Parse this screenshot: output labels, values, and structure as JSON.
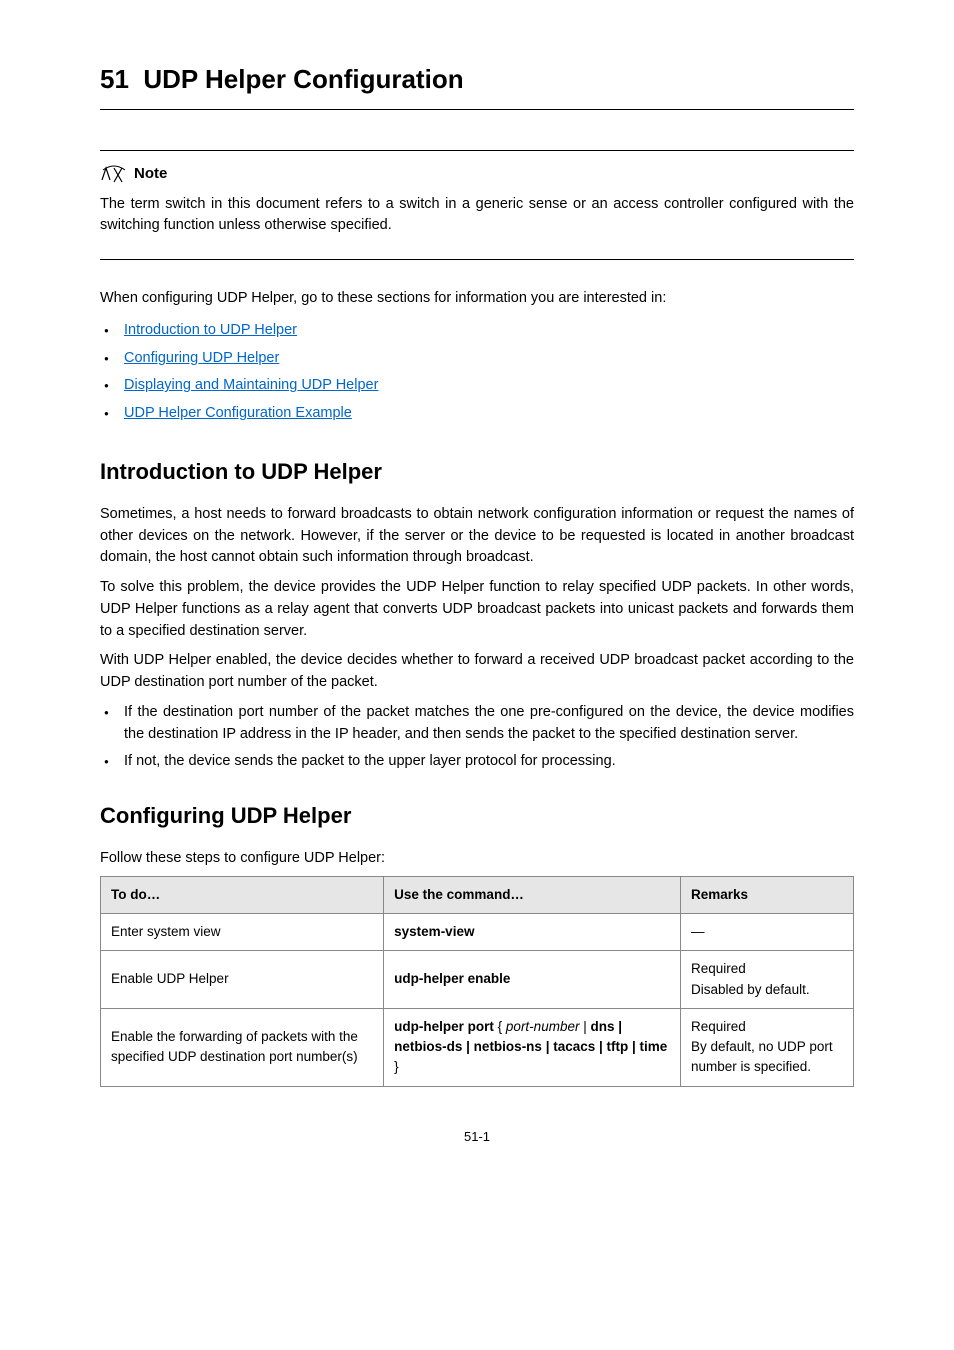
{
  "chapter": {
    "number": "51",
    "title": "UDP Helper Configuration"
  },
  "note": {
    "label": "Note",
    "text": "The term switch in this document refers to a switch in a generic sense or an access controller configured with the switching function unless otherwise specified."
  },
  "intro_line": "When configuring UDP Helper, go to these sections for information you are interested in:",
  "links": [
    "Introduction to UDP Helper",
    "Configuring UDP Helper",
    "Displaying and Maintaining UDP Helper",
    "UDP Helper Configuration Example"
  ],
  "section_intro": {
    "heading": "Introduction to UDP Helper",
    "paragraphs": [
      "Sometimes, a host needs to forward broadcasts to obtain network configuration information or request the names of other devices on the network. However, if the server or the device to be requested is located in another broadcast domain, the host cannot obtain such information through broadcast.",
      "To solve this problem, the device provides the UDP Helper function to relay specified UDP packets. In other words, UDP Helper functions as a relay agent that converts UDP broadcast packets into unicast packets and forwards them to a specified destination server.",
      "With UDP Helper enabled, the device decides whether to forward a received UDP broadcast packet according to the UDP destination port number of the packet."
    ],
    "bullets": [
      "If the destination port number of the packet matches the one pre-configured on the device, the device modifies the destination IP address in the IP header, and then sends the packet to the specified destination server.",
      "If not, the device sends the packet to the upper layer protocol for processing."
    ]
  },
  "section_config": {
    "heading": "Configuring UDP Helper",
    "steps_line": "Follow these steps to configure UDP Helper:",
    "table": {
      "headers": [
        "To do…",
        "Use the command…",
        "Remarks"
      ],
      "rows": [
        {
          "todo": "Enter system view",
          "cmd_bold": "system-view",
          "cmd_rest": "",
          "remarks": "—"
        },
        {
          "todo": "Enable UDP Helper",
          "cmd_bold": "udp-helper enable",
          "cmd_rest": "",
          "remarks_l1": "Required",
          "remarks_l2": "Disabled by default."
        },
        {
          "todo": "Enable the forwarding of packets with the specified UDP destination port number(s)",
          "cmd_bold": "udp-helper port",
          "cmd_rest_open": " { ",
          "cmd_arg": "port-number",
          "cmd_rest_mid": " | ",
          "cmd_opts": "dns | netbios-ds | netbios-ns | tacacs | tftp | time",
          "cmd_rest_close": " }",
          "remarks_l1": "Required",
          "remarks_l2": "By default, no UDP port number is specified."
        }
      ]
    }
  },
  "page_number": "51-1"
}
